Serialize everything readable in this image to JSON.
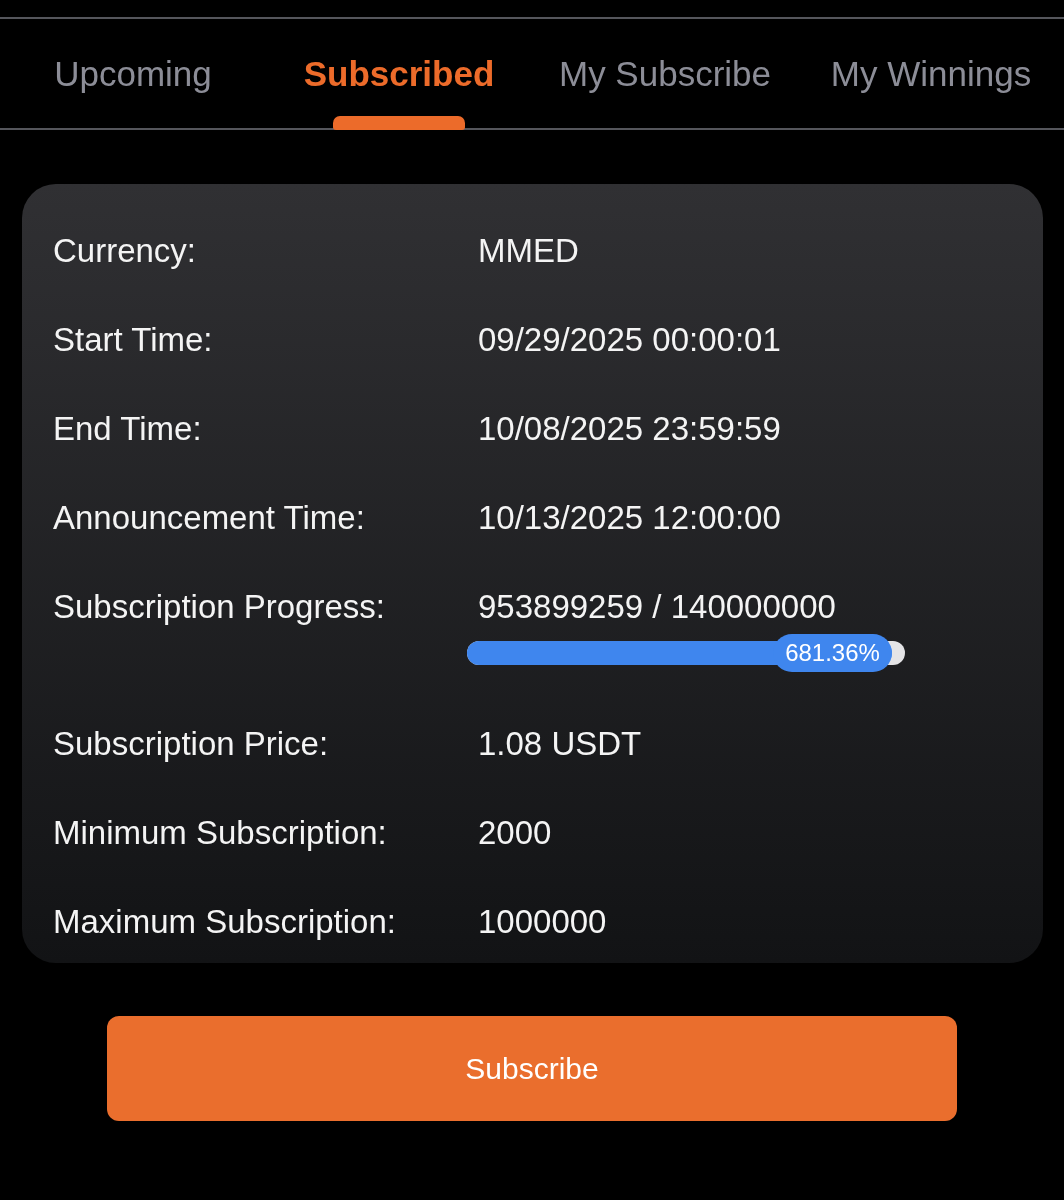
{
  "tabs": [
    {
      "label": "Upcoming",
      "selected": false
    },
    {
      "label": "Subscribed",
      "selected": true
    },
    {
      "label": "My Subscribe",
      "selected": false
    },
    {
      "label": "My Winnings",
      "selected": false
    }
  ],
  "details": [
    {
      "kind": "text",
      "label": "Currency:",
      "value": "MMED"
    },
    {
      "kind": "text",
      "label": "Start Time:",
      "value": "09/29/2025 00:00:01"
    },
    {
      "kind": "text",
      "label": "End Time:",
      "value": "10/08/2025 23:59:59"
    },
    {
      "kind": "text",
      "label": "Announcement Time:",
      "value": "10/13/2025 12:00:00"
    },
    {
      "kind": "progress",
      "label": "Subscription Progress:",
      "value": "953899259 / 140000000",
      "level": 0.97,
      "reading": "681.36%"
    },
    {
      "kind": "text",
      "label": "Subscription Price:",
      "value": "1.08 USDT"
    },
    {
      "kind": "text",
      "label": "Minimum Subscription:",
      "value": "2000"
    },
    {
      "kind": "text",
      "label": "Maximum Subscription:",
      "value": "1000000"
    }
  ],
  "subscribe_button": "Subscribe"
}
